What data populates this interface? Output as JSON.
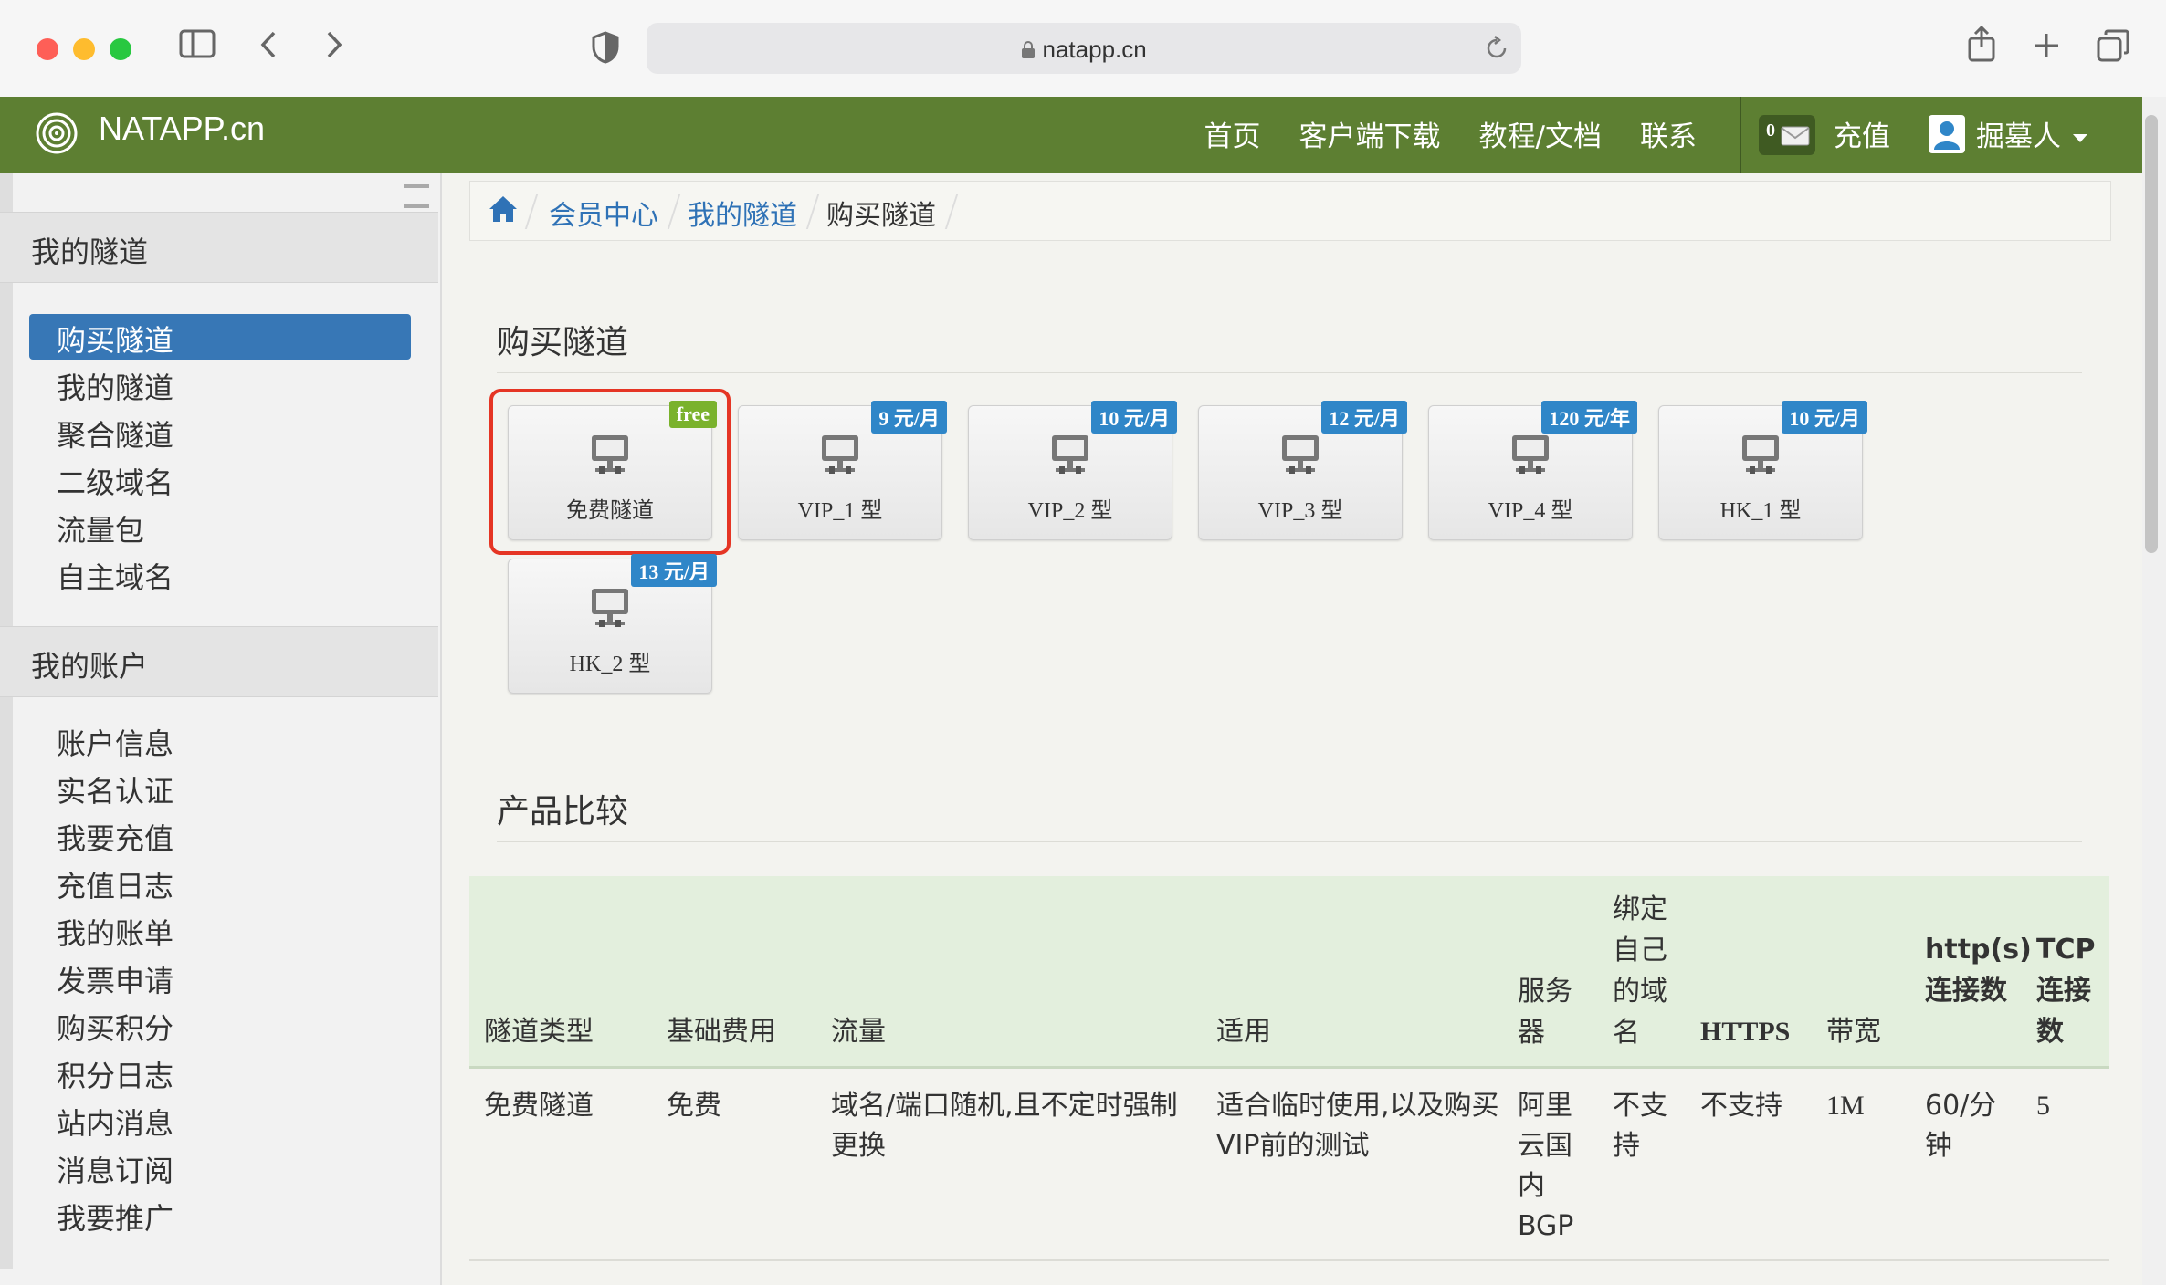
{
  "browser": {
    "url": "natapp.cn"
  },
  "navbar": {
    "brand": "NATAPP.cn",
    "links": [
      "首页",
      "客户端下载",
      "教程/文档",
      "联系"
    ],
    "message_count": "0",
    "recharge": "充值",
    "user": "掘墓人"
  },
  "sidebar": {
    "tunnel_section": "我的隧道",
    "tunnel_items": [
      "购买隧道",
      "我的隧道",
      "聚合隧道",
      "二级域名",
      "流量包",
      "自主域名"
    ],
    "account_section": "我的账户",
    "account_items": [
      "账户信息",
      "实名认证",
      "我要充值",
      "充值日志",
      "我的账单",
      "发票申请",
      "购买积分",
      "积分日志",
      "站内消息",
      "消息订阅",
      "我要推广"
    ]
  },
  "breadcrumb": [
    "会员中心",
    "我的隧道",
    "购买隧道"
  ],
  "buy": {
    "title": "购买隧道",
    "tiles": [
      {
        "label": "免费隧道",
        "badge": "free"
      },
      {
        "label": "VIP_1 型",
        "badge": "9 元/月"
      },
      {
        "label": "VIP_2 型",
        "badge": "10 元/月"
      },
      {
        "label": "VIP_3 型",
        "badge": "12 元/月"
      },
      {
        "label": "VIP_4 型",
        "badge": "120 元/年"
      },
      {
        "label": "HK_1 型",
        "badge": "10 元/月"
      },
      {
        "label": "HK_2 型",
        "badge": "13 元/月"
      }
    ]
  },
  "compare": {
    "title": "产品比较",
    "headers": [
      "隧道类型",
      "基础费用",
      "流量",
      "适用",
      "服务器",
      "绑定自己的域名",
      "HTTPS",
      "带宽",
      "http(s)连接数",
      "TCP连接数"
    ],
    "rows": [
      [
        "免费隧道",
        "免费",
        "域名/端口随机,且不定时强制更换",
        "适合临时使用,以及购买VIP前的测试",
        "阿里云国内BGP",
        "不支持",
        "不支持",
        "1M",
        "60/分钟",
        "5"
      ]
    ]
  }
}
